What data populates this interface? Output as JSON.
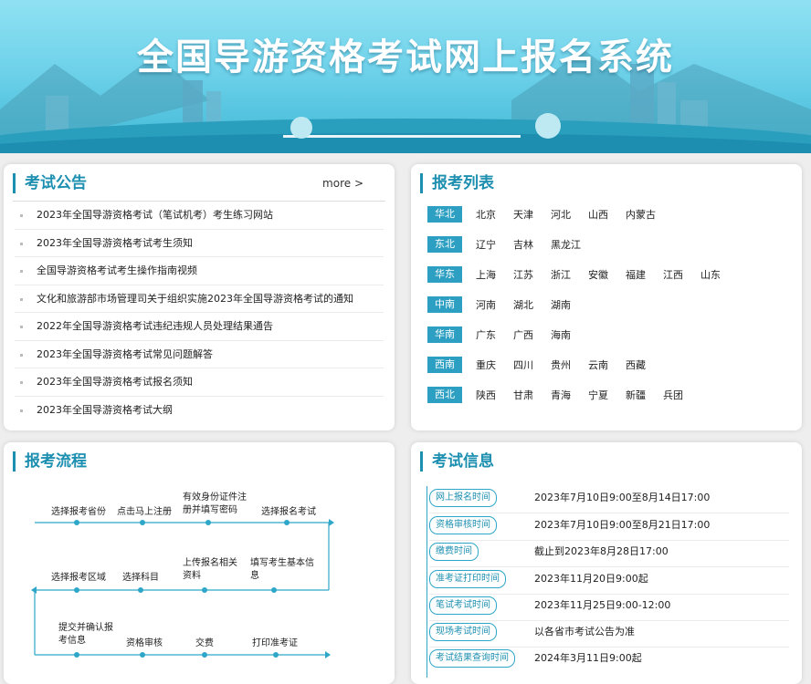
{
  "header": {
    "title": "全国导游资格考试网上报名系统"
  },
  "announcements": {
    "title": "考试公告",
    "more_label": "more >",
    "items": [
      "2023年全国导游资格考试（笔试机考）考生练习网站",
      "2023年全国导游资格考试考生须知",
      "全国导游资格考试考生操作指南视频",
      "文化和旅游部市场管理司关于组织实施2023年全国导游资格考试的通知",
      "2022年全国导游资格考试违纪违规人员处理结果通告",
      "2023年全国导游资格考试常见问题解答",
      "2023年全国导游资格考试报名须知",
      "2023年全国导游资格考试大纲"
    ]
  },
  "regions": {
    "title": "报考列表",
    "groups": [
      {
        "name": "华北",
        "cities": [
          "北京",
          "天津",
          "河北",
          "山西",
          "内蒙古"
        ]
      },
      {
        "name": "东北",
        "cities": [
          "辽宁",
          "吉林",
          "黑龙江"
        ]
      },
      {
        "name": "华东",
        "cities": [
          "上海",
          "江苏",
          "浙江",
          "安徽",
          "福建",
          "江西",
          "山东"
        ]
      },
      {
        "name": "中南",
        "cities": [
          "河南",
          "湖北",
          "湖南"
        ]
      },
      {
        "name": "华南",
        "cities": [
          "广东",
          "广西",
          "海南"
        ]
      },
      {
        "name": "西南",
        "cities": [
          "重庆",
          "四川",
          "贵州",
          "云南",
          "西藏"
        ]
      },
      {
        "name": "西北",
        "cities": [
          "陕西",
          "甘肃",
          "青海",
          "宁夏",
          "新疆",
          "兵团"
        ]
      }
    ]
  },
  "process": {
    "title": "报考流程",
    "row1": [
      "选择报考省份",
      "点击马上注册",
      "有效身份证件注册并填写密码",
      "选择报名考试"
    ],
    "row2": [
      "选择报考区域",
      "选择科目",
      "上传报名相关资料",
      "填写考生基本信息"
    ],
    "row3": [
      "提交并确认报考信息",
      "资格审核",
      "交费",
      "打印准考证"
    ]
  },
  "exam_info": {
    "title": "考试信息",
    "items": [
      {
        "label": "网上报名时间",
        "value": "2023年7月10日9:00至8月14日17:00"
      },
      {
        "label": "资格审核时间",
        "value": "2023年7月10日9:00至8月21日17:00"
      },
      {
        "label": "缴费时间",
        "value": "截止到2023年8月28日17:00"
      },
      {
        "label": "准考证打印时间",
        "value": "2023年11月20日9:00起"
      },
      {
        "label": "笔试考试时间",
        "value": "2023年11月25日9:00-12:00"
      },
      {
        "label": "现场考试时间",
        "value": "以各省市考试公告为准"
      },
      {
        "label": "考试结果查询时间",
        "value": "2024年3月11日9:00起"
      }
    ]
  }
}
